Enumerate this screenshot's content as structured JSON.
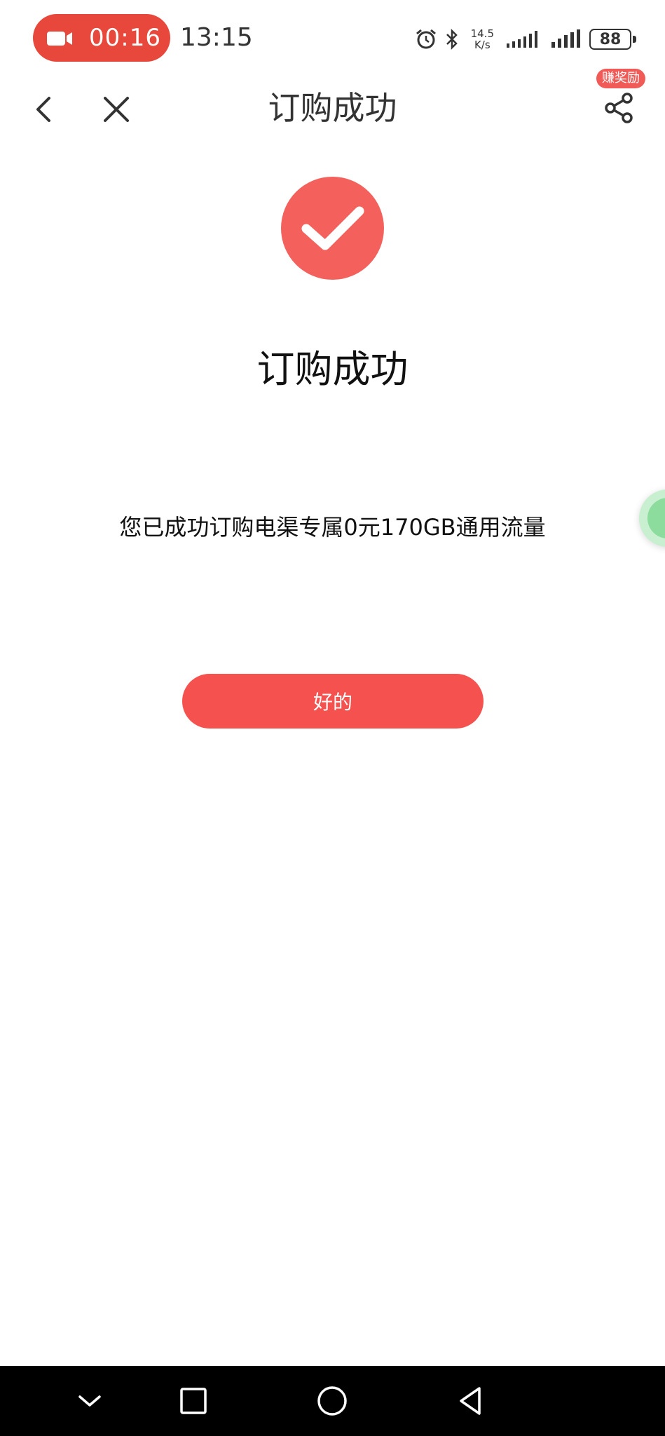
{
  "status_bar": {
    "recording_time": "00:16",
    "clock": "13:15",
    "net_speed_value": "14.5",
    "net_speed_unit": "K/s",
    "battery": "88"
  },
  "nav": {
    "title": "订购成功",
    "reward_badge": "赚奖励"
  },
  "content": {
    "title": "订购成功",
    "message": "您已成功订购电渠专属0元170GB通用流量",
    "ok_button": "好的"
  },
  "colors": {
    "accent": "#f5514e",
    "recording": "#e8483b",
    "success_circle": "#f4615c"
  },
  "icons": {
    "back": "back-chevron-icon",
    "close": "close-icon",
    "share": "share-icon",
    "success": "checkmark-icon"
  }
}
